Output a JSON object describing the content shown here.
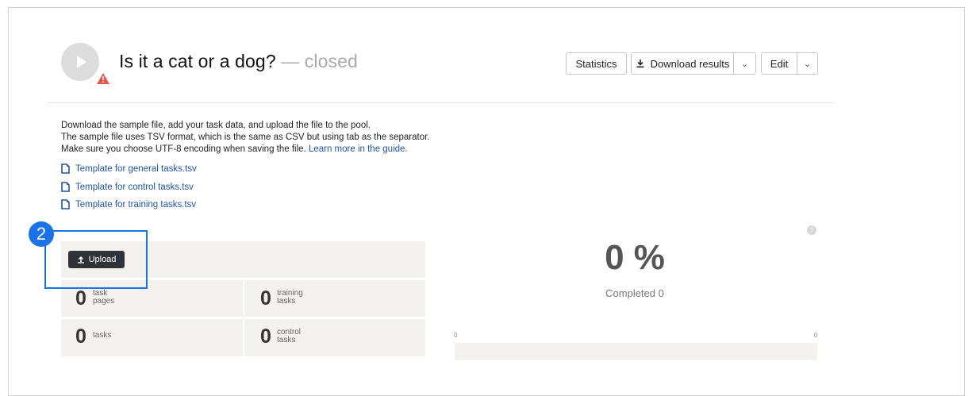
{
  "header": {
    "title": "Is it a cat or a dog?",
    "status": " — closed",
    "statistics_label": "Statistics",
    "download_label": "Download results",
    "edit_label": "Edit"
  },
  "instructions": {
    "line1": "Download the sample file, add your task data, and upload the file to the pool.",
    "line2": "The sample file uses TSV format, which is the same as CSV but using tab as the separator.",
    "line3": "Make sure you choose UTF-8 encoding when saving the file. ",
    "guide_link": "Learn more in the guide."
  },
  "templates": [
    "Template for general tasks.tsv",
    "Template for control tasks.tsv",
    "Template for training tasks.tsv"
  ],
  "upload": {
    "button_label": "Upload",
    "callout_number": "2"
  },
  "stats": {
    "task_pages": {
      "value": "0",
      "label_line1": "task",
      "label_line2": "pages"
    },
    "training_tasks": {
      "value": "0",
      "label_line1": "training",
      "label_line2": "tasks"
    },
    "tasks": {
      "value": "0",
      "label_line1": "",
      "label_line2": "tasks"
    },
    "control_tasks": {
      "value": "0",
      "label_line1": "control",
      "label_line2": "tasks"
    }
  },
  "progress": {
    "percent_text": "0 %",
    "completed_text": "Completed 0",
    "axis_min": "0",
    "axis_max": "0",
    "fraction": 0,
    "help_glyph": "?"
  },
  "colors": {
    "link": "#1e56b0",
    "callout": "#1a73e8",
    "warning": "#e8564f",
    "upload_button": "#2e3338"
  }
}
